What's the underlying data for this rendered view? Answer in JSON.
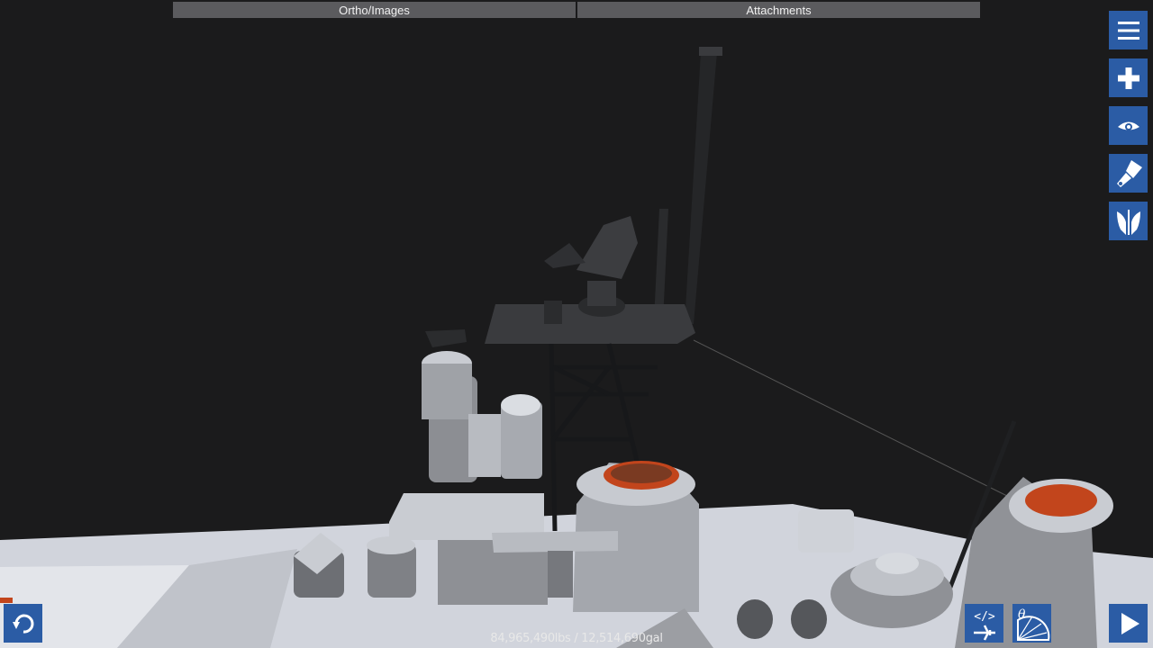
{
  "tabs": [
    {
      "label": "Ortho/Images"
    },
    {
      "label": "Attachments"
    }
  ],
  "toolbar": {
    "buttons": [
      {
        "icon": "menu-icon"
      },
      {
        "icon": "add-part-icon"
      },
      {
        "icon": "view-icon"
      },
      {
        "icon": "paint-icon"
      },
      {
        "icon": "symmetry-icon"
      }
    ]
  },
  "bottom": {
    "undo_icon": "undo-icon",
    "xml_icon": "xml-aircraft-icon",
    "angle_icon": "angle-protractor-icon",
    "play_icon": "play-icon"
  },
  "status": {
    "mass_fuel": "84,965,490lbs / 12,514,690gal"
  },
  "colors": {
    "background": "#1b1b1c",
    "accent": "#2b5ca5",
    "tab_bg": "#5b5b5e",
    "hull": "#c8cbd3",
    "dark_part": "#2f3033",
    "orange_rim": "#c2451c"
  }
}
